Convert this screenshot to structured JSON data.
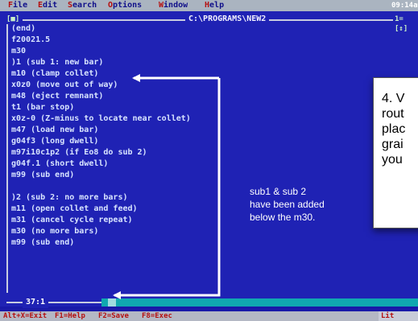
{
  "menu": {
    "items": [
      {
        "key": "F",
        "rest": "ile"
      },
      {
        "key": "E",
        "rest": "dit"
      },
      {
        "key": "S",
        "rest": "earch"
      },
      {
        "key": "O",
        "rest": "ptions"
      },
      {
        "key": "W",
        "rest": "indow"
      },
      {
        "key": "H",
        "rest": "elp"
      }
    ],
    "clock": "09:14am"
  },
  "window": {
    "control": "[■]",
    "path": "C:\\PROGRAMS\\NEW2",
    "number": "1=[↕]"
  },
  "code": [
    "(end)",
    "f20021.5",
    "m30",
    ")1 (sub 1: new bar)",
    "m10 (clamp collet)",
    "x0z0 (move out of way)",
    "m48 (eject remnant)",
    "t1 (bar stop)",
    "x0z-0 (Z-minus to locate near collet)",
    "m47 (load new bar)",
    "g04f3 (long dwell)",
    "m97i10c1p2 (if Eo8 do sub 2)",
    "g04f.1 (short dwell)",
    "m99 (sub end)",
    "",
    ")2 (sub 2: no more bars)",
    "m11 (open collet and feed)",
    "m31 (cancel cycle repeat)",
    "m30 (no more bars)",
    "m99 (sub end)"
  ],
  "annotation": {
    "line1": "sub1 & sub 2",
    "line2": "have been added",
    "line3": "below the m30."
  },
  "note": {
    "lines": [
      "4. V",
      "rout",
      "plac",
      "grai",
      "you"
    ]
  },
  "position": "37:1",
  "status": {
    "items": [
      "Alt+X=Exit",
      "F1=Help",
      "F2=Save",
      "F8=Exec"
    ],
    "mode": "Lit Edit"
  },
  "colors": {
    "editor_bg": "#1f22b4",
    "menubar_bg": "#aab4c0",
    "text": "#d8e4ff",
    "arrow": "#ffffff"
  }
}
